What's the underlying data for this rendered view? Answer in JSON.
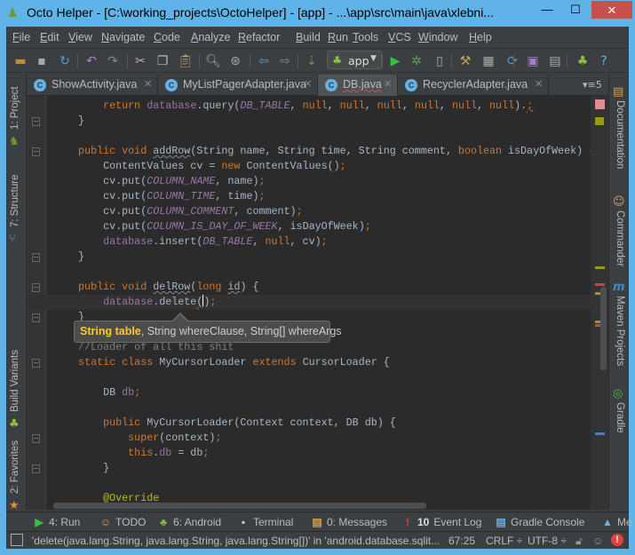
{
  "window": {
    "title": "Octo Helper - [C:\\working_projects\\OctoHelper] - [app] - ...\\app\\src\\main\\java\\xlebni...",
    "minimize": "—",
    "maximize": "☐",
    "close": "✕"
  },
  "menu": [
    "File",
    "Edit",
    "View",
    "Navigate",
    "Code",
    "Analyze",
    "Refactor",
    "Build",
    "Run",
    "Tools",
    "VCS",
    "Window",
    "Help"
  ],
  "toolbar": {
    "run_config": "app",
    "icons": [
      "open-folder-icon",
      "save-icon",
      "sync-icon",
      "undo-icon",
      "redo-icon",
      "cut-icon",
      "copy-icon",
      "paste-icon",
      "find-icon",
      "replace-icon",
      "back-icon",
      "forward-icon",
      "make-icon",
      "android-icon",
      "run-icon",
      "debug-icon",
      "attach-debugger-icon",
      "project-structure-icon",
      "sdk-manager-icon",
      "avd-manager-icon",
      "sync-gradle-icon",
      "device-monitor-icon",
      "android-sdk-icon",
      "help-icon"
    ]
  },
  "tabs": [
    {
      "label": "ShowActivity.java",
      "active": false
    },
    {
      "label": "MyListPagerAdapter.java",
      "active": false
    },
    {
      "label": "DB.java",
      "active": true
    },
    {
      "label": "RecyclerAdapter.java",
      "active": false
    }
  ],
  "tabs_overflow": "5",
  "left_panels": [
    {
      "label": "1: Project",
      "icon": "android-project-icon"
    },
    {
      "label": "7: Structure",
      "icon": "structure-icon"
    },
    {
      "label": "Build Variants",
      "icon": "android-icon"
    },
    {
      "label": "2: Favorites",
      "icon": "star-icon"
    }
  ],
  "right_panels": [
    {
      "label": "Documentation",
      "icon": "documentation-icon"
    },
    {
      "label": "Commander",
      "icon": "commander-icon"
    },
    {
      "label": "Maven Projects",
      "icon": "maven-icon"
    },
    {
      "label": "Gradle",
      "icon": "gradle-icon"
    }
  ],
  "code": [
    [
      [
        "        return ",
        "k"
      ],
      [
        "database",
        "fn"
      ],
      [
        ".query(",
        ""
      ],
      [
        "DB_TABLE",
        "f"
      ],
      [
        ", ",
        ""
      ],
      [
        "null",
        "k"
      ],
      [
        ", ",
        ""
      ],
      [
        "null",
        "k"
      ],
      [
        ", ",
        ""
      ],
      [
        "null",
        "k"
      ],
      [
        ", ",
        ""
      ],
      [
        "null",
        "k"
      ],
      [
        ", ",
        ""
      ],
      [
        "null",
        "k"
      ],
      [
        ", ",
        ""
      ],
      [
        "null",
        "k"
      ],
      [
        ").",
        ""
      ],
      [
        ";",
        "k err"
      ]
    ],
    [
      [
        "    }",
        ""
      ]
    ],
    [],
    [
      [
        "    public void ",
        "k"
      ],
      [
        "addRow",
        "w"
      ],
      [
        "(String name, String time, String comment, ",
        ""
      ],
      [
        "boolean ",
        "k"
      ],
      [
        "isDayOfWeek) {",
        ""
      ]
    ],
    [
      [
        "        ContentValues cv = ",
        ""
      ],
      [
        "new ",
        "k"
      ],
      [
        "ContentValues()",
        ""
      ],
      [
        ";",
        "k"
      ]
    ],
    [
      [
        "        cv.put(",
        ""
      ],
      [
        "COLUMN_NAME",
        "f"
      ],
      [
        ", name)",
        ""
      ],
      [
        ";",
        "k"
      ]
    ],
    [
      [
        "        cv.put(",
        ""
      ],
      [
        "COLUMN_TIME",
        "f"
      ],
      [
        ", time)",
        ""
      ],
      [
        ";",
        "k"
      ]
    ],
    [
      [
        "        cv.put(",
        ""
      ],
      [
        "COLUMN_COMMENT",
        "f"
      ],
      [
        ", comment)",
        ""
      ],
      [
        ";",
        "k"
      ]
    ],
    [
      [
        "        cv.put(",
        ""
      ],
      [
        "COLUMN_IS_DAY_OF_WEEK",
        "f"
      ],
      [
        ", isDayOfWeek)",
        ""
      ],
      [
        ";",
        "k"
      ]
    ],
    [
      [
        "        ",
        ""
      ],
      [
        "database",
        "fn"
      ],
      [
        ".insert(",
        ""
      ],
      [
        "DB_TABLE",
        "f"
      ],
      [
        ", ",
        ""
      ],
      [
        "null",
        "k"
      ],
      [
        ", cv)",
        ""
      ],
      [
        ";",
        "k"
      ]
    ],
    [
      [
        "    }",
        ""
      ]
    ],
    [],
    [
      [
        "    public void ",
        "k"
      ],
      [
        "delRow",
        "w"
      ],
      [
        "(",
        ""
      ],
      [
        "long ",
        "k"
      ],
      [
        "id",
        "w"
      ],
      [
        ") {",
        ""
      ]
    ],
    [
      [
        "        ",
        ""
      ],
      [
        "database",
        "fn"
      ],
      [
        ".delete",
        ""
      ],
      [
        "(",
        "err"
      ],
      [
        "CARET",
        ""
      ],
      [
        ")",
        ""
      ],
      [
        ";",
        "k"
      ]
    ],
    [
      [
        "    }",
        ""
      ]
    ],
    [],
    [
      [
        "    //Loader of all this shit",
        "c"
      ]
    ],
    [
      [
        "    static class ",
        "k"
      ],
      [
        "MyCursorLoader ",
        ""
      ],
      [
        "extends ",
        "k"
      ],
      [
        "CursorLoader {",
        ""
      ]
    ],
    [],
    [
      [
        "        DB ",
        ""
      ],
      [
        "db",
        "fn"
      ],
      [
        ";",
        "k"
      ]
    ],
    [],
    [
      [
        "        public ",
        "k"
      ],
      [
        "MyCursorLoader(Context context, DB db) {",
        ""
      ]
    ],
    [
      [
        "            super",
        "k"
      ],
      [
        "(context)",
        ""
      ],
      [
        ";",
        "k"
      ]
    ],
    [
      [
        "            this",
        "k"
      ],
      [
        ".",
        ""
      ],
      [
        "db",
        "fn"
      ],
      [
        " = db",
        ""
      ],
      [
        ";",
        "k"
      ]
    ],
    [
      [
        "        }",
        ""
      ]
    ],
    [],
    [
      [
        "        @Override",
        "a"
      ]
    ]
  ],
  "current_line": 13,
  "tooltip": {
    "bold": "String table",
    "rest": ", String whereClause, String[] whereArgs"
  },
  "tool_windows": [
    {
      "label": "4: Run",
      "icon": "run-icon"
    },
    {
      "label": "TODO",
      "icon": "todo-icon"
    },
    {
      "label": "6: Android",
      "icon": "android-icon"
    },
    {
      "label": "Terminal",
      "icon": "terminal-icon"
    },
    {
      "label": "0: Messages",
      "icon": "messages-icon"
    },
    {
      "label": "Event Log",
      "icon": "event-log-icon",
      "badge": "10"
    },
    {
      "label": "Gradle Console",
      "icon": "gradle-console-icon"
    },
    {
      "label": "Me",
      "icon": "maven-icon"
    }
  ],
  "status": {
    "message": "'delete(java.lang.String, java.lang.String, java.lang.String[])' in 'android.database.sqlit...",
    "position": "67:25",
    "line_sep": "CRLF ÷",
    "encoding": "UTF-8 ÷"
  },
  "colors": {
    "keyword": "#cc7832",
    "field": "#9876aa",
    "text": "#a9b7c6",
    "comment": "#808080",
    "annotation": "#bbb529",
    "accent": "#5fb3e6",
    "error": "#c7504f"
  }
}
